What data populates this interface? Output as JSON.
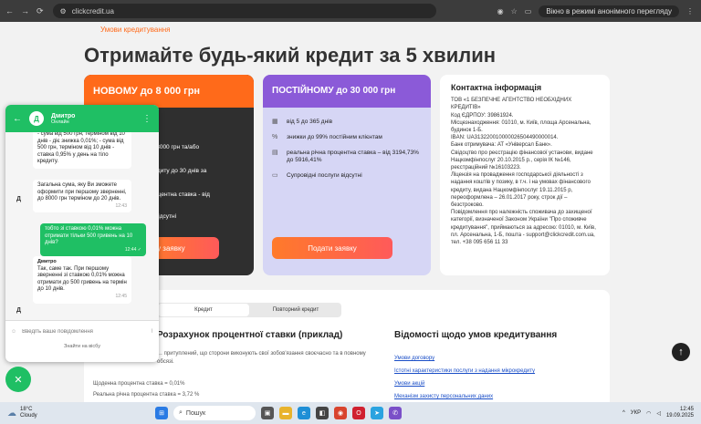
{
  "browser": {
    "url": "clickcredit.ua",
    "incognito_label": "Вікно в режимі анонімного перегляду"
  },
  "page": {
    "breadcrumb": "Умови кредитування",
    "headline": "Отримайте будь-який кредит за 5 хвилин",
    "card_new": {
      "title": "НОВОМУ до 8 000 грн",
      "features": [
        "до 8000 грн та/або",
        "кредиту до 30 днів за",
        "процентна ставка - від",
        "ги відсутні"
      ],
      "button": "ву заявку"
    },
    "card_regular": {
      "title": "ПОСТІЙНОМУ до 30 000 грн",
      "features": [
        {
          "icon": "calendar-icon",
          "text": "від 5 до 365 днів"
        },
        {
          "icon": "percent-icon",
          "text": "знижки до 99% постійним клієнтам"
        },
        {
          "icon": "document-icon",
          "text": "реальна річна процентна ставка – від 3194,73% до 5916,41%"
        },
        {
          "icon": "card-icon",
          "text": "Супровідні послуги відсутні"
        }
      ],
      "button": "Подати заявку"
    },
    "contact": {
      "title": "Контактна інформація",
      "lines": [
        "ТОВ «1 БЕЗПЕЧНЕ АГЕНТСТВО НЕОБХІДНИХ КРЕДИТІВ»",
        "Код ЄДРПОУ: 39861924.",
        "Місцезнаходження: 01010, м. Київ, площа Арсенальна, будинок 1-Б.",
        "IBAN: UA313220010000026504490000014.",
        "Банк отримувача: АТ «Універсал Банк».",
        "Свідоцтво про реєстрацію фінансової установи, видане Нацкомфінпослуг 20.10.2015 р., серія ІК №146, реєстраційний №16103223.",
        "Ліцензія на провадження господарської діяльності з надання коштів у позику, в т.ч. і на умовах фінансового кредиту, видана Нацкомфінпослуг 19.11.2015 р, переоформлена – 26.01.2017 року, строк дії – безстроково.",
        "Повідомлення про належність споживача до захищеної категорії, визначеної Законом України \"Про споживче кредитування\", приймаються за адресою: 01010, м. Київ, пл. Арсенальна, 1-Б, пошта - support@clickcredit.com.ua, тел. +38 095 656 11 33"
      ]
    },
    "tabs": [
      "Кредит",
      "Повторний кредит"
    ],
    "lower_heading": "Розрахунок процентної ставки (приклад)",
    "lower_text": [
      "… притуплений, що сторони виконують свої зобов'язання своєчасно та в повному обсязі.",
      "Щоденна процентна ставка = 0,01%",
      "Реальна річна процентна ставка = 3,72 %"
    ],
    "info_heading": "Відомості щодо умов кредитування",
    "info_links": [
      "Умови договору",
      "Істотні характеристики послуги з надання мікрокредиту",
      "Умови акцій",
      "Механізм захисту персональних даних"
    ]
  },
  "chat": {
    "agent_name": "Дмитро",
    "agent_status": "Онлайн",
    "avatar_letter": "Д",
    "messages": [
      {
        "from": "bot",
        "text": "- сума від 500 грн, терміном від 10 днів - діє знижка 0,01%; - сума від 500 грн, терміном від 10 днів - ставка 0,95% у день на тіло кредиту.",
        "time": ""
      },
      {
        "from": "bot",
        "text": "Загальна сума, яку Ви зможете оформити при першому зверненні, до 8000 грн терміном до 20 днів.",
        "time": "12:43"
      },
      {
        "from": "user",
        "text": "тобто зі ставкою 0,01% можна отримати тільки 500 гривень на 10 днів?",
        "time": "12:44 ✓"
      },
      {
        "from": "bot",
        "author": "Дмитро",
        "text": "Так, саме так. При першому зверненні зі ставкою 0,01% можна отримати до 500 гривень на термін до 10 днів.",
        "time": "12:45"
      }
    ],
    "input_placeholder": "Введіть ваше повідомлення",
    "powered": "Знайти на вісбу"
  },
  "taskbar": {
    "temp": "18°C",
    "weather": "Cloudy",
    "search": "Пошук",
    "lang": "УКР",
    "time": "12:45",
    "date": "19.09.2025"
  }
}
